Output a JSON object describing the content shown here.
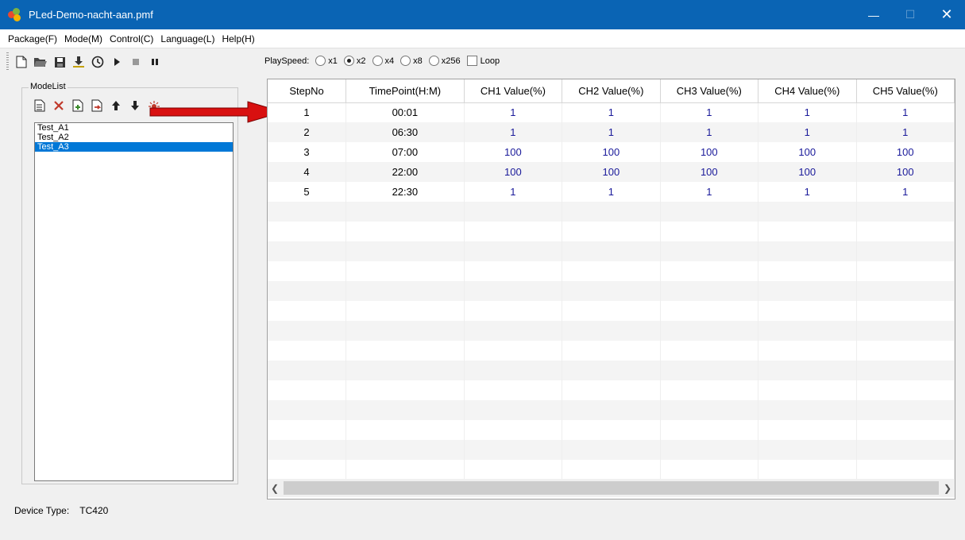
{
  "window": {
    "title": "PLed-Demo-nacht-aan.pmf"
  },
  "menu": [
    "Package(F)",
    "Mode(M)",
    "Control(C)",
    "Language(L)",
    "Help(H)"
  ],
  "toolbar": {
    "playspeed_label": "PlaySpeed:",
    "speeds": [
      "x1",
      "x2",
      "x4",
      "x8",
      "x256"
    ],
    "selected_speed": "x2",
    "loop_label": "Loop",
    "loop_checked": false
  },
  "modelist": {
    "title": "ModeList",
    "items": [
      "Test_A1",
      "Test_A2",
      "Test_A3"
    ],
    "selected": "Test_A3"
  },
  "table": {
    "columns": [
      "StepNo",
      "TimePoint(H:M)",
      "CH1 Value(%)",
      "CH2 Value(%)",
      "CH3 Value(%)",
      "CH4 Value(%)",
      "CH5 Value(%)"
    ],
    "rows": [
      [
        "1",
        "00:01",
        "1",
        "1",
        "1",
        "1",
        "1"
      ],
      [
        "2",
        "06:30",
        "1",
        "1",
        "1",
        "1",
        "1"
      ],
      [
        "3",
        "07:00",
        "100",
        "100",
        "100",
        "100",
        "100"
      ],
      [
        "4",
        "22:00",
        "100",
        "100",
        "100",
        "100",
        "100"
      ],
      [
        "5",
        "22:30",
        "1",
        "1",
        "1",
        "1",
        "1"
      ]
    ]
  },
  "status": {
    "device_type_label": "Device Type:",
    "device_type_value": "TC420"
  },
  "colors": {
    "titlebar": "#0a64b4",
    "selection": "#0078d7",
    "value_text": "#1a1a9a",
    "arrow": "#d81010"
  }
}
